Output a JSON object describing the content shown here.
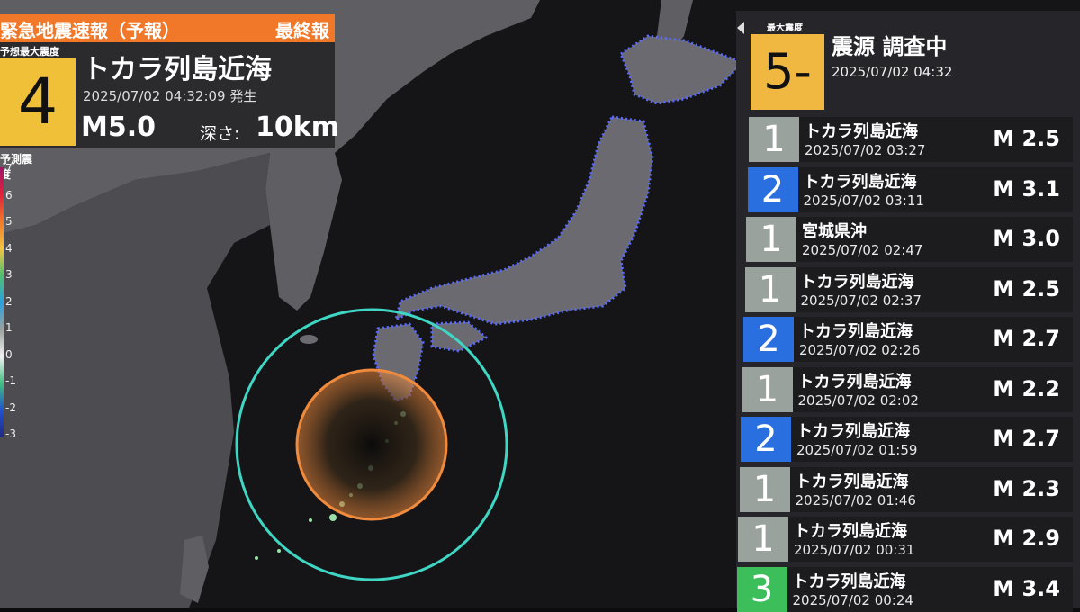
{
  "alert": {
    "title": "緊急地震速報（予報）",
    "final_label": "最終報",
    "max_intensity_label": "予想最大震度",
    "max_intensity": "4",
    "region": "トカラ列島近海",
    "datetime": "2025/07/02 04:32:09 発生",
    "magnitude": "M5.0",
    "depth_label": "深さ:",
    "depth_value": "10km",
    "color": "#f07828"
  },
  "legend": {
    "title": "予測震度",
    "ticks": [
      "7",
      "6",
      "5",
      "4",
      "3",
      "2",
      "1",
      "0",
      "-1",
      "-2",
      "-3"
    ]
  },
  "side_panel": {
    "max_intensity_label": "最大震度",
    "max_intensity": "5-",
    "status": "震源 調査中",
    "status_time": "2025/07/02 04:32",
    "events": [
      {
        "intensity": "1",
        "region": "トカラ列島近海",
        "time": "2025/07/02 03:27",
        "magnitude": "M 2.5",
        "color": "#9aa29e"
      },
      {
        "intensity": "2",
        "region": "トカラ列島近海",
        "time": "2025/07/02 03:11",
        "magnitude": "M 3.1",
        "color": "#2a6fe0"
      },
      {
        "intensity": "1",
        "region": "宮城県沖",
        "time": "2025/07/02 02:47",
        "magnitude": "M 3.0",
        "color": "#9aa29e"
      },
      {
        "intensity": "1",
        "region": "トカラ列島近海",
        "time": "2025/07/02 02:37",
        "magnitude": "M 2.5",
        "color": "#9aa29e"
      },
      {
        "intensity": "2",
        "region": "トカラ列島近海",
        "time": "2025/07/02 02:26",
        "magnitude": "M 2.7",
        "color": "#2a6fe0"
      },
      {
        "intensity": "1",
        "region": "トカラ列島近海",
        "time": "2025/07/02 02:02",
        "magnitude": "M 2.2",
        "color": "#9aa29e"
      },
      {
        "intensity": "2",
        "region": "トカラ列島近海",
        "time": "2025/07/02 01:59",
        "magnitude": "M 2.7",
        "color": "#2a6fe0"
      },
      {
        "intensity": "1",
        "region": "トカラ列島近海",
        "time": "2025/07/02 01:46",
        "magnitude": "M 2.3",
        "color": "#9aa29e"
      },
      {
        "intensity": "1",
        "region": "トカラ列島近海",
        "time": "2025/07/02 00:31",
        "magnitude": "M 2.9",
        "color": "#9aa29e"
      },
      {
        "intensity": "3",
        "region": "トカラ列島近海",
        "time": "2025/07/02 00:24",
        "magnitude": "M 3.4",
        "color": "#3cbf5a"
      }
    ]
  },
  "map": {
    "s_wave_color": "#f08a3c",
    "p_wave_color": "#3fd6c4",
    "land_color": "#6a6a6e"
  }
}
